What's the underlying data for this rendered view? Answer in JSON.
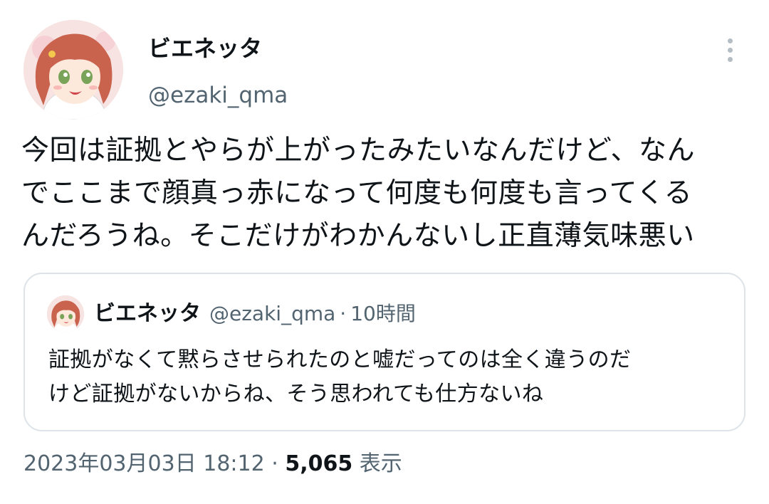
{
  "author": {
    "display_name": "ビエネッタ",
    "handle": "@ezaki_qma",
    "avatar_icon": "anime-girl-avatar"
  },
  "more_menu_icon": "more-vertical-icon",
  "tweet": {
    "lines": [
      "今回は証拠とやらが上がったみたいなんだけど、なん",
      "でここまで顔真っ赤になって何度も何度も言ってくる",
      "んだろうね。そこだけがわかんないし正直薄気味悪い"
    ]
  },
  "quote": {
    "display_name": "ビエネッタ",
    "handle": "@ezaki_qma",
    "separator": "·",
    "time": "10時間",
    "lines": [
      "証拠がなくて黙らさせられたのと嘘だってのは全く違うのだ",
      "けど証拠がないからね、そう思われても仕方ないね"
    ]
  },
  "meta": {
    "timestamp": "2023年03月03日 18:12",
    "separator": "·",
    "views_count": "5,065",
    "views_label": "表示"
  },
  "colors": {
    "text_primary": "#0f1419",
    "text_secondary": "#536471",
    "border": "#dde3e8",
    "hair": "#c9634e"
  }
}
